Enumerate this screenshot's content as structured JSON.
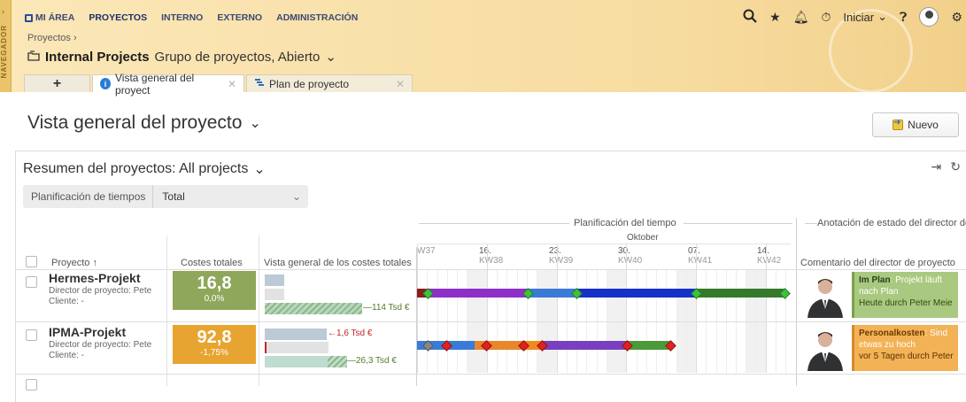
{
  "nav": {
    "rail_label": "NAVEGADOR",
    "items": [
      "MI ÁREA",
      "PROYECTOS",
      "INTERNO",
      "EXTERNO",
      "ADMINISTRACIÓN"
    ],
    "active": "PROYECTOS"
  },
  "header": {
    "breadcrumb": "Proyectos ›",
    "project_name": "Internal Projects",
    "project_subtitle": "Grupo de proyectos, Abierto",
    "start_label": "Iniciar"
  },
  "tabs": [
    {
      "label": "Vista general del proyect",
      "active": true
    },
    {
      "label": "Plan de proyecto",
      "active": false
    }
  ],
  "page": {
    "title": "Vista general del proyecto",
    "new_button": "Nuevo"
  },
  "panel": {
    "title": "Resumen del proyectos: All projects",
    "filter_label": "Planificación de tiempos",
    "filter_value": "Total"
  },
  "table": {
    "headers": {
      "project": "Proyecto ↑",
      "costs": "Costes totales",
      "cost_overview": "Vista general de los costes totales",
      "time_group": "Planificación del tiempo",
      "month": "Oktober",
      "status_group": "Anotación de estado del director de",
      "status_col": "Comentario del director de proyecto"
    },
    "weeks": [
      {
        "day": "",
        "kw": "W37"
      },
      {
        "day": "16.",
        "kw": "KW38"
      },
      {
        "day": "23.",
        "kw": "KW39"
      },
      {
        "day": "30.",
        "kw": "KW40"
      },
      {
        "day": "07.",
        "kw": "KW41"
      },
      {
        "day": "14.",
        "kw": "KW42"
      }
    ],
    "rows": [
      {
        "name": "Hermes-Projekt",
        "manager": "Director de proyecto: Pete",
        "client": "Cliente: -",
        "cost_value": "16,8",
        "cost_pct": "0,0%",
        "cost_color": "#8fa75a",
        "bar_label": "114 Tsd €",
        "comment_kw": "Im Plan",
        "comment_text": ": Projekt läuft nach Plan",
        "comment_meta": "Heute durch Peter Meie"
      },
      {
        "name": "IPMA-Projekt",
        "manager": "Director de proyecto: Pete",
        "client": "Cliente: -",
        "cost_value": "92,8",
        "cost_pct": "-1,75%",
        "cost_color": "#e8a430",
        "bar_label_top": "1,6 Tsd €",
        "bar_label": "26,3 Tsd €",
        "comment_kw": "Personalkosten",
        "comment_text": ": Sind etwas zu hoch",
        "comment_meta": "vor 5 Tagen durch Peter"
      }
    ]
  }
}
